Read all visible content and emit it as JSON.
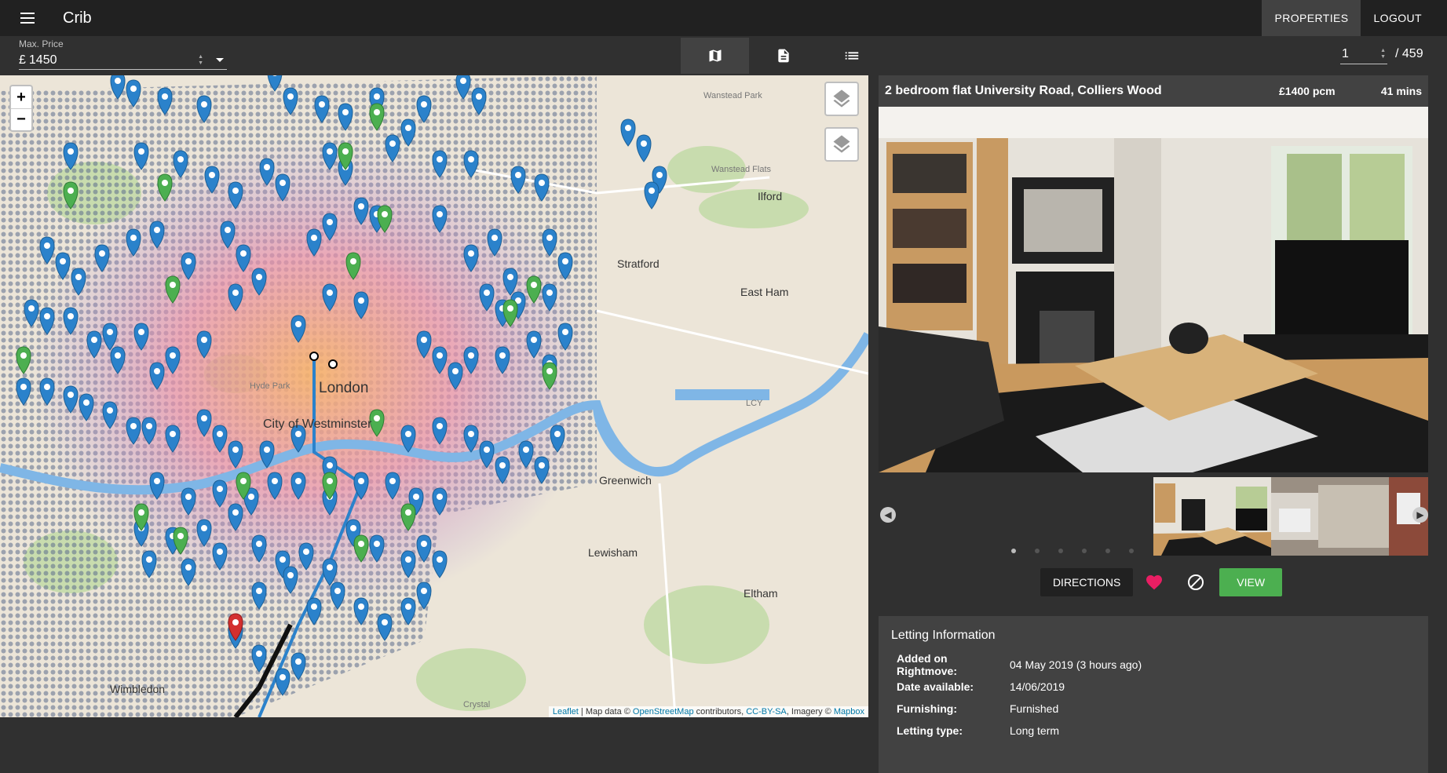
{
  "appbar": {
    "title": "Crib",
    "nav": [
      "PROPERTIES",
      "LOGOUT"
    ]
  },
  "toolbar": {
    "price_label": "Max. Price",
    "price_prefix": "£",
    "price_value": "1450",
    "pager_value": "1",
    "pager_total": "/ 459"
  },
  "map": {
    "attribution": {
      "leaflet": "Leaflet",
      "sep1": " | Map data © ",
      "osm": "OpenStreetMap",
      "contrib": " contributors, ",
      "license": "CC-BY-SA",
      "imagery": ", Imagery © ",
      "mapbox": "Mapbox"
    },
    "labels": {
      "london": "London",
      "westminster": "City of Westminster",
      "ilford": "Ilford",
      "stratford": "Stratford",
      "east_ham": "East Ham",
      "greenwich": "Greenwich",
      "lewisham": "Lewisham",
      "eltham": "Eltham",
      "wimbledon": "Wimbledon",
      "wanstead": "Wanstead Park",
      "wanstead_flats": "Wanstead Flats",
      "lcy": "LCY",
      "hyde_park": "Hyde Park",
      "crystal": "Crystal"
    },
    "zoom_in": "+",
    "zoom_out": "−"
  },
  "property": {
    "title": "2 bedroom flat University Road, Colliers Wood",
    "price": "£1400 pcm",
    "travel_time": "41 mins",
    "actions": {
      "directions": "DIRECTIONS",
      "view": "VIEW"
    },
    "info_title": "Letting Information",
    "info": [
      {
        "key": "Added on Rightmove:",
        "value": "04 May 2019 (3 hours ago)"
      },
      {
        "key": "Date available:",
        "value": "14/06/2019"
      },
      {
        "key": "Furnishing:",
        "value": "Furnished"
      },
      {
        "key": "Letting type:",
        "value": "Long term"
      }
    ]
  },
  "colors": {
    "accent_green": "#4caf50",
    "heart": "#e91e63",
    "marker_blue": "#2b82cb",
    "marker_green": "#4caf50",
    "marker_red": "#d32f2f"
  }
}
